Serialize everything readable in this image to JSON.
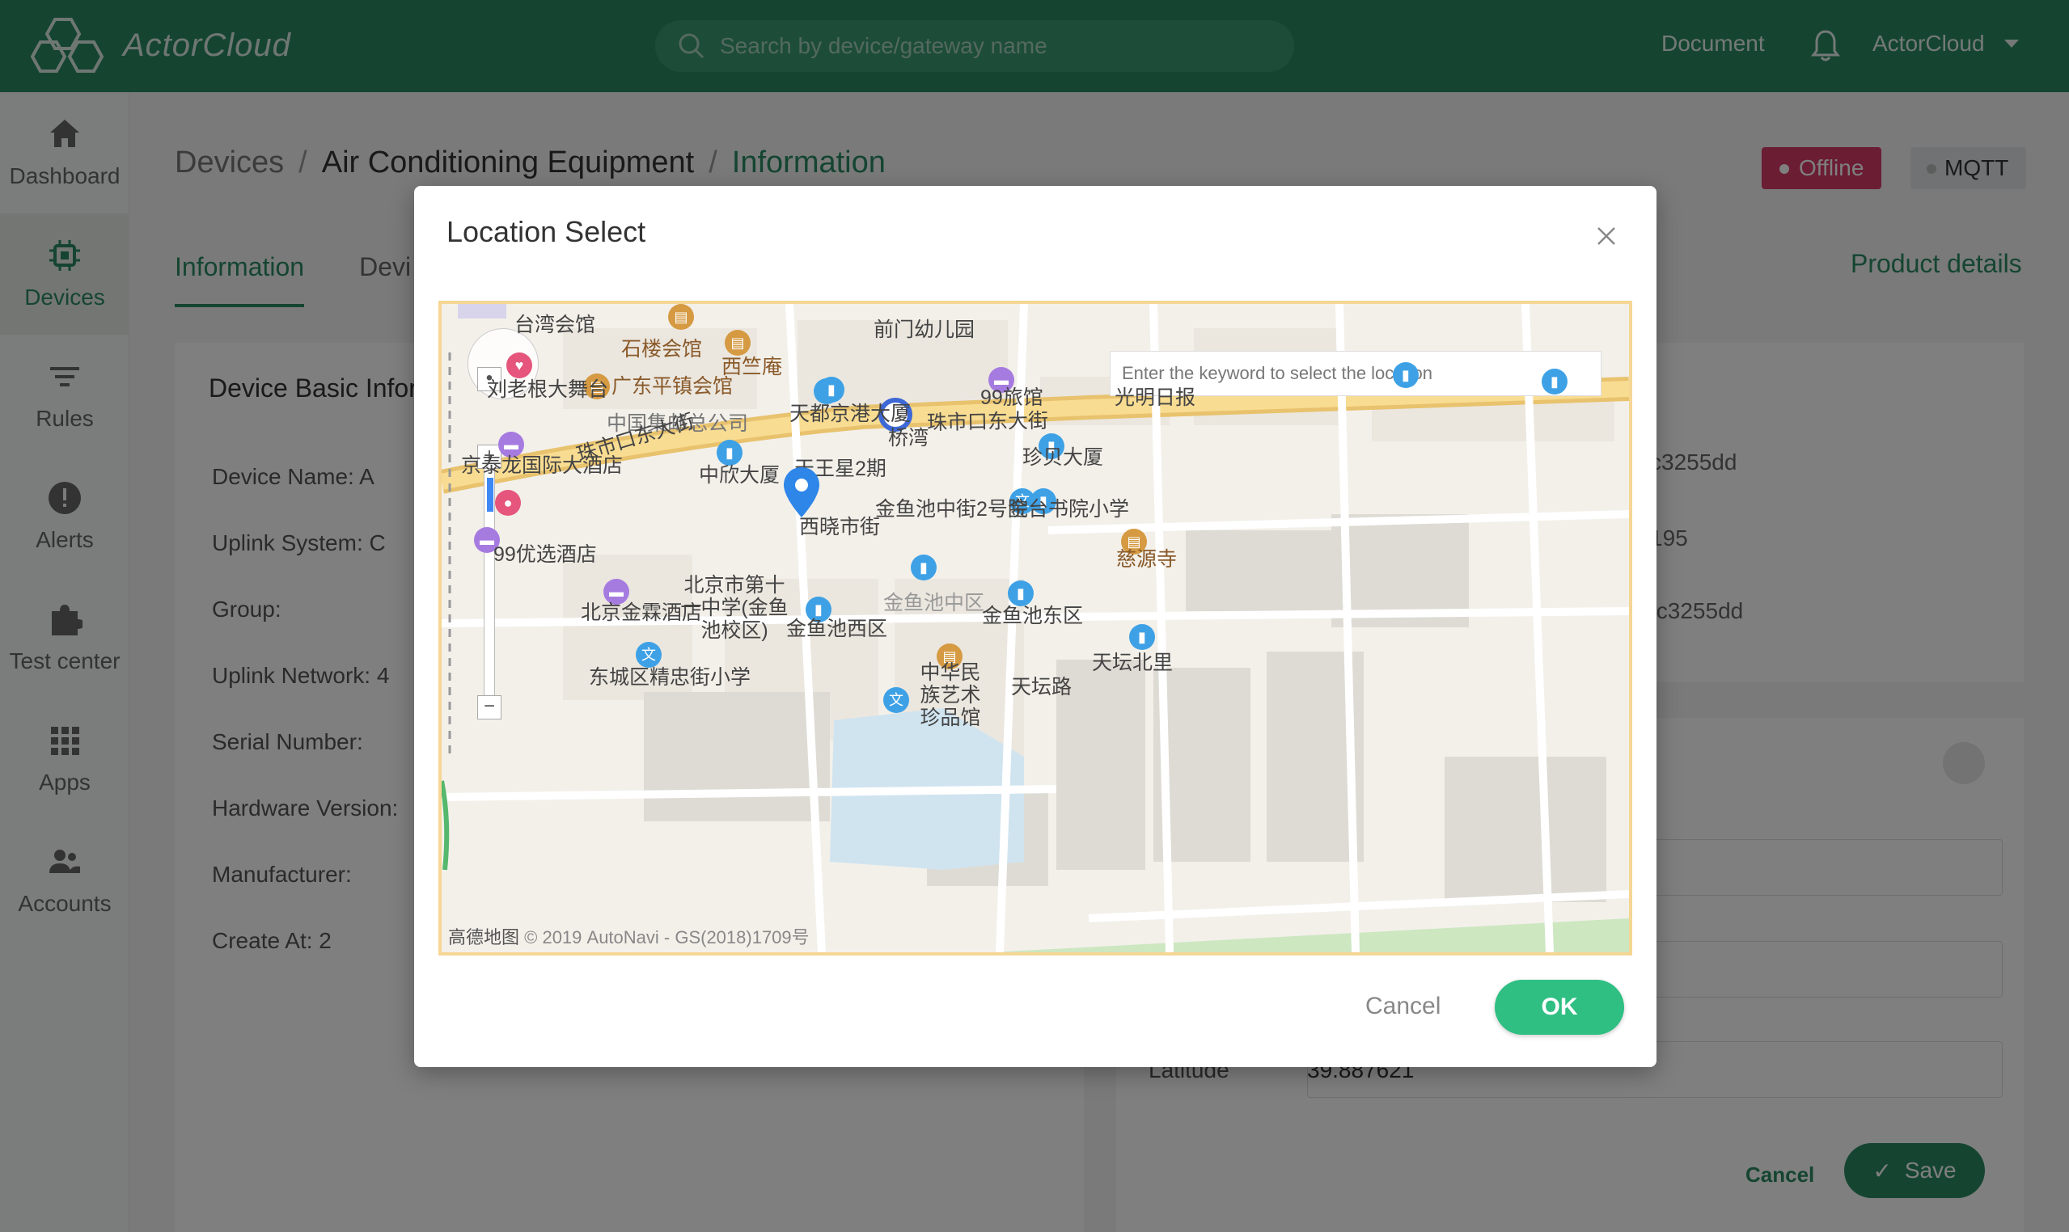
{
  "header": {
    "logo_text": "ActorCloud",
    "search_placeholder": "Search by device/gateway name",
    "document_label": "Document",
    "user_label": "ActorCloud",
    "bell_icon": "bell-icon",
    "brand_color": "#2a8b62"
  },
  "sidebar": {
    "items": [
      {
        "label": "Dashboard",
        "icon": "home-icon"
      },
      {
        "label": "Devices",
        "icon": "chip-icon",
        "active": true
      },
      {
        "label": "Rules",
        "icon": "filter-icon"
      },
      {
        "label": "Alerts",
        "icon": "alert-icon"
      },
      {
        "label": "Test center",
        "icon": "puzzle-icon"
      },
      {
        "label": "Apps",
        "icon": "grid-icon"
      },
      {
        "label": "Accounts",
        "icon": "users-icon"
      }
    ]
  },
  "breadcrumb": {
    "items": [
      "Devices",
      "Air Conditioning Equipment",
      "Information"
    ],
    "separator": "/"
  },
  "badges": {
    "status": "Offline",
    "protocol": "MQTT",
    "status_color": "#d63b66"
  },
  "tabs": {
    "items": [
      "Information",
      "Devi"
    ],
    "product_details": "Product details"
  },
  "basic_info": {
    "title": "Device Basic Infor",
    "fields": [
      {
        "label": "Device Name:",
        "partial_value": "A"
      },
      {
        "label": "Uplink System:",
        "partial_value": "C"
      },
      {
        "label": "Group:",
        "partial_value": ""
      },
      {
        "label": "Uplink Network:",
        "partial_value": "4"
      },
      {
        "label": "Serial Number:",
        "partial_value": ""
      },
      {
        "label": "Hardware Version:",
        "partial_value": ""
      },
      {
        "label": "Manufacturer:",
        "partial_value": ""
      },
      {
        "label": "Create At:",
        "partial_value": "2"
      }
    ]
  },
  "right_panel": {
    "values": [
      "c3255dd",
      "195",
      "fc3255dd"
    ],
    "latitude_label": "Latitude",
    "latitude_value": "39.887621",
    "cancel_label": "Cancel",
    "save_label": "Save"
  },
  "modal": {
    "title": "Location Select",
    "map_search_placeholder": "Enter the keyword to select the location",
    "cancel_label": "Cancel",
    "ok_label": "OK",
    "ok_color": "#2fbf83",
    "map_attribution_brand": "高德地图",
    "map_attribution": "© 2019 AutoNavi - GS(2018)1709号",
    "map_labels": [
      {
        "text": "台湾会馆",
        "color": "dark"
      },
      {
        "text": "前门幼儿园",
        "color": "dark"
      },
      {
        "text": "石楼会馆",
        "color": "brown"
      },
      {
        "text": "西竺庵",
        "color": "brown"
      },
      {
        "text": "刘老根大舞台",
        "color": "dark"
      },
      {
        "text": "广东平镇会馆",
        "color": "brown"
      },
      {
        "text": "99旅馆",
        "color": "dark"
      },
      {
        "text": "光明日报",
        "color": "dark"
      },
      {
        "text": "中国集邮总公司",
        "color": "dark"
      },
      {
        "text": "天都京港大厦",
        "color": "dark"
      },
      {
        "text": "珠市口东大街",
        "color": "dark"
      },
      {
        "text": "桥湾",
        "color": "dark"
      },
      {
        "text": "京泰龙国际大酒店",
        "color": "dark"
      },
      {
        "text": "珠市口东大街",
        "color": "dark"
      },
      {
        "text": "珍贝大厦",
        "color": "dark"
      },
      {
        "text": "中欣大厦",
        "color": "dark"
      },
      {
        "text": "天王星2期",
        "color": "dark"
      },
      {
        "text": "金鱼池中街2号院",
        "color": "dark"
      },
      {
        "text": "金台书院小学",
        "color": "dark"
      },
      {
        "text": "西晓市街",
        "color": "dark"
      },
      {
        "text": "99优选酒店",
        "color": "dark"
      },
      {
        "text": "慈源寺",
        "color": "brown"
      },
      {
        "text": "北京市第十一中学(金鱼池校区)",
        "color": "dark"
      },
      {
        "text": "金鱼池中区",
        "color": "gray"
      },
      {
        "text": "北京金霖酒店",
        "color": "dark"
      },
      {
        "text": "金鱼池西区",
        "color": "dark"
      },
      {
        "text": "金鱼池东区",
        "color": "dark"
      },
      {
        "text": "天坛北里",
        "color": "dark"
      },
      {
        "text": "东城区精忠街小学",
        "color": "dark"
      },
      {
        "text": "中华民族艺术珍品馆",
        "color": "dark"
      },
      {
        "text": "天坛路",
        "color": "dark"
      }
    ]
  }
}
